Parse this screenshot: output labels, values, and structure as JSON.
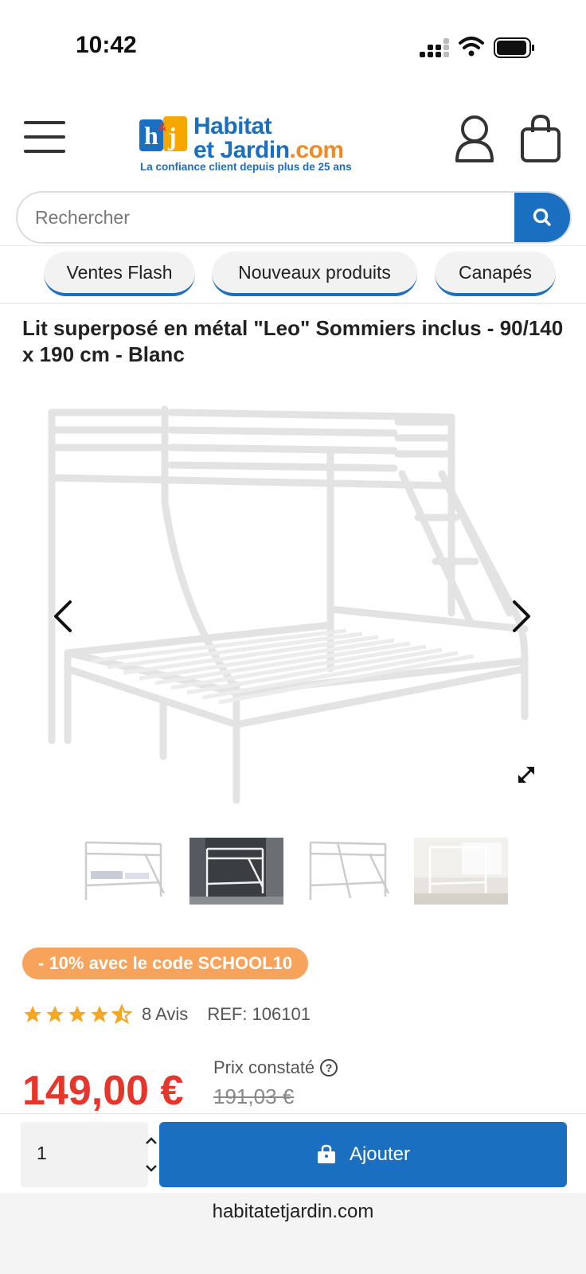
{
  "status_bar": {
    "time": "10:42"
  },
  "header": {
    "logo_line1": "Habitat",
    "logo_line2": "et Jardin",
    "logo_domain": ".com",
    "logo_tagline": "La confiance client depuis plus de 25 ans",
    "logo_mark": "h&j"
  },
  "search": {
    "placeholder": "Rechercher"
  },
  "categories": [
    "Ventes Flash",
    "Nouveaux produits",
    "Canapés"
  ],
  "product": {
    "title": "Lit superposé en métal \"Leo\" Sommiers inclus - 90/140 x 190 cm - Blanc",
    "promo": "- 10% avec le code SCHOOL10",
    "rating": 4.5,
    "reviews": "8 Avis",
    "ref": "REF: 106101",
    "price": "149,00 €",
    "reference_price_label": "Prix constaté",
    "reference_price": "191,03 €"
  },
  "cart_bar": {
    "quantity": "1",
    "add_label": "Ajouter"
  },
  "browser": {
    "url": "habitatetjardin.com"
  },
  "colors": {
    "brand_blue": "#1a6fc0",
    "promo_orange": "#f7a35c",
    "price_red": "#e8352b",
    "star": "#f5a623"
  }
}
